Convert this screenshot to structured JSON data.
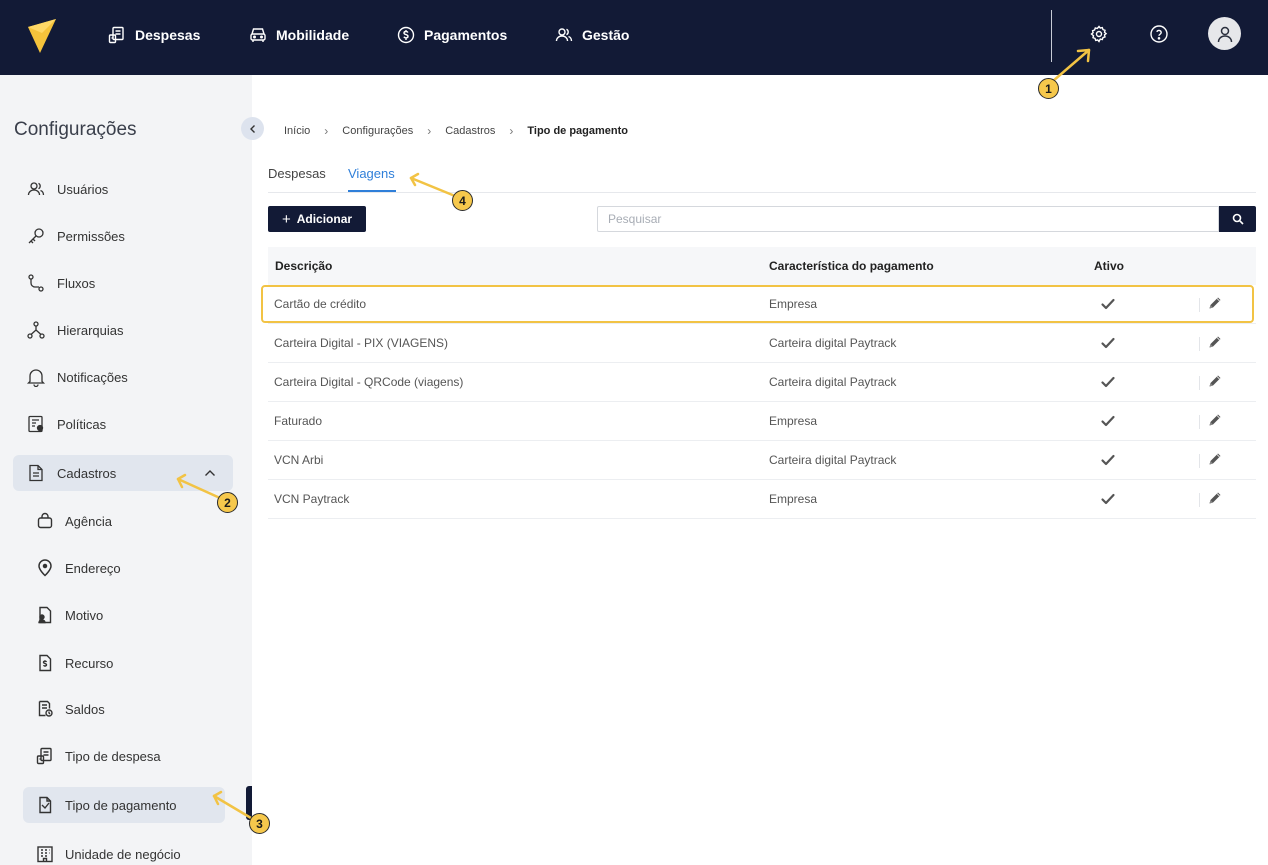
{
  "nav": {
    "items": [
      {
        "label": "Despesas",
        "icon": "receipt-icon"
      },
      {
        "label": "Mobilidade",
        "icon": "car-icon"
      },
      {
        "label": "Pagamentos",
        "icon": "dollar-circle-icon"
      },
      {
        "label": "Gestão",
        "icon": "users-icon"
      }
    ],
    "icons": [
      "gear-icon",
      "help-icon",
      "avatar-icon"
    ],
    "background": "#121a36",
    "logo_color": "#f5c33b"
  },
  "sidebar": {
    "title": "Configurações",
    "items": [
      {
        "label": "Usuários",
        "icon": "users-icon"
      },
      {
        "label": "Permissões",
        "icon": "key-icon"
      },
      {
        "label": "Fluxos",
        "icon": "flow-icon"
      },
      {
        "label": "Hierarquias",
        "icon": "hierarchy-icon"
      },
      {
        "label": "Notificações",
        "icon": "bell-icon"
      },
      {
        "label": "Políticas",
        "icon": "policy-icon"
      }
    ],
    "group": {
      "label": "Cadastros",
      "icon": "document-icon",
      "expanded": true
    },
    "subitems": [
      {
        "label": "Agência",
        "icon": "bag-icon"
      },
      {
        "label": "Endereço",
        "icon": "location-icon"
      },
      {
        "label": "Motivo",
        "icon": "file-user-icon"
      },
      {
        "label": "Recurso",
        "icon": "file-dollar-icon"
      },
      {
        "label": "Saldos",
        "icon": "balance-icon"
      },
      {
        "label": "Tipo de despesa",
        "icon": "receipt-icon"
      },
      {
        "label": "Tipo de pagamento",
        "icon": "payment-type-icon",
        "active": true
      },
      {
        "label": "Unidade de negócio",
        "icon": "building-icon"
      }
    ]
  },
  "breadcrumb": [
    "Início",
    "Configurações",
    "Cadastros",
    "Tipo de pagamento"
  ],
  "tabs": [
    {
      "label": "Despesas",
      "active": false
    },
    {
      "label": "Viagens",
      "active": true
    }
  ],
  "toolbar": {
    "add_label": "Adicionar",
    "search_placeholder": "Pesquisar"
  },
  "table": {
    "headers": [
      "Descrição",
      "Característica do pagamento",
      "Ativo"
    ],
    "rows": [
      {
        "descricao": "Cartão de crédito",
        "caracteristica": "Empresa",
        "ativo": true
      },
      {
        "descricao": "Carteira Digital - PIX (VIAGENS)",
        "caracteristica": "Carteira digital Paytrack",
        "ativo": true
      },
      {
        "descricao": "Carteira Digital - QRCode (viagens)",
        "caracteristica": "Carteira digital Paytrack",
        "ativo": true
      },
      {
        "descricao": "Faturado",
        "caracteristica": "Empresa",
        "ativo": true
      },
      {
        "descricao": "VCN Arbi",
        "caracteristica": "Carteira digital Paytrack",
        "ativo": true
      },
      {
        "descricao": "VCN Paytrack",
        "caracteristica": "Empresa",
        "ativo": true
      }
    ]
  },
  "annotations": {
    "callouts": [
      "1",
      "2",
      "3",
      "4"
    ],
    "color": "#f6c84c"
  },
  "colors": {
    "accent": "#2f7fd9",
    "dark": "#121a36",
    "highlight": "#f2c344"
  }
}
